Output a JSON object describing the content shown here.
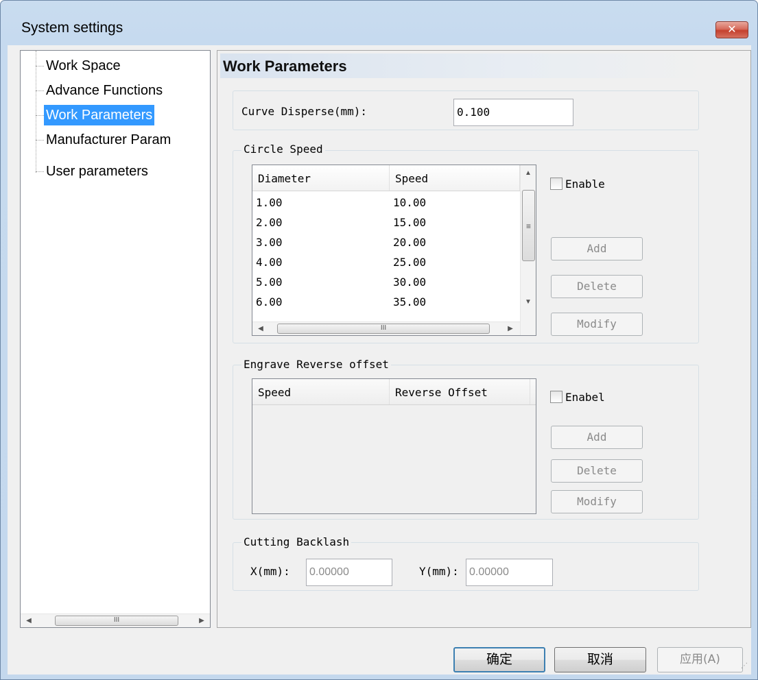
{
  "window": {
    "title": "System settings",
    "close_glyph": "✕"
  },
  "tree": {
    "items": [
      {
        "label": "Work Space"
      },
      {
        "label": "Advance Functions"
      },
      {
        "label": "Work Parameters",
        "selected": true
      },
      {
        "label": "Manufacturer Param"
      },
      {
        "label": "User parameters"
      }
    ],
    "scroll_thumb_glyph": "III"
  },
  "panel": {
    "title": "Work Parameters",
    "curve_disperse": {
      "label": "Curve Disperse(mm):",
      "value": "0.100"
    },
    "circle_speed": {
      "group_label": "Circle Speed",
      "columns": [
        "Diameter",
        "Speed"
      ],
      "rows": [
        [
          "1.00",
          "10.00"
        ],
        [
          "2.00",
          "15.00"
        ],
        [
          "3.00",
          "20.00"
        ],
        [
          "4.00",
          "25.00"
        ],
        [
          "5.00",
          "30.00"
        ],
        [
          "6.00",
          "35.00"
        ]
      ],
      "enable_label": "Enable",
      "add_label": "Add",
      "delete_label": "Delete",
      "modify_label": "Modify",
      "hscroll_glyph": "III",
      "vscroll_glyph": "≡"
    },
    "engrave_reverse": {
      "group_label": "Engrave Reverse offset",
      "columns": [
        "Speed",
        "Reverse Offset"
      ],
      "enable_label": "Enabel",
      "add_label": "Add",
      "delete_label": "Delete",
      "modify_label": "Modify"
    },
    "cutting_backlash": {
      "group_label": "Cutting Backlash",
      "x_label": "X(mm):",
      "x_value": "0.00000",
      "y_label": "Y(mm):",
      "y_value": "0.00000"
    }
  },
  "footer": {
    "ok_label": "确定",
    "cancel_label": "取消",
    "apply_label": "应用(A)"
  }
}
